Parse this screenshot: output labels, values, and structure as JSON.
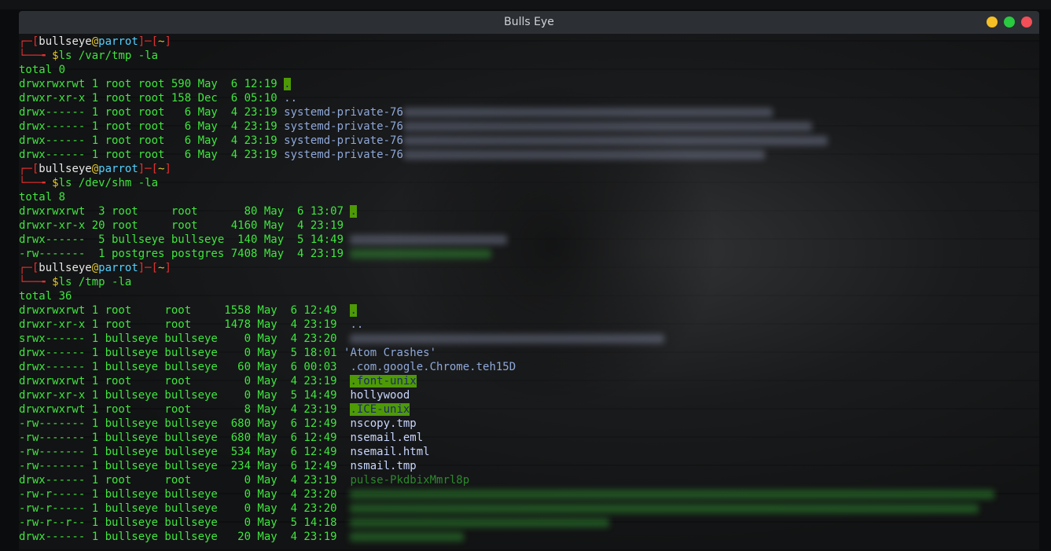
{
  "window": {
    "title": "Bulls Eye"
  },
  "prompt": {
    "bracket_open": "┌─[",
    "user": "bullseye",
    "at": "@",
    "host": "parrot",
    "mid": "]─[",
    "cwd": "~",
    "bracket_close": "]",
    "arrow": "└──╼ ",
    "dollar": "$"
  },
  "blocks": [
    {
      "command": "ls /var/tmp -la",
      "total": "total 0",
      "rows": [
        {
          "meta": "drwxrwxrwt 1 root root 590 May  6 12:19 ",
          "name": ".",
          "style": "hl"
        },
        {
          "meta": "drwxr-xr-x 1 root root 158 Dec  6 05:10 ",
          "name": "..",
          "style": "dir"
        },
        {
          "meta": "drwx------ 1 root root   6 May  4 23:19 ",
          "name": "systemd-private-76",
          "style": "dir"
        },
        {
          "meta": "drwx------ 1 root root   6 May  4 23:19 ",
          "name": "systemd-private-76",
          "style": "dir"
        },
        {
          "meta": "drwx------ 1 root root   6 May  4 23:19 ",
          "name": "systemd-private-76",
          "style": "dir"
        },
        {
          "meta": "drwx------ 1 root root   6 May  4 23:19 ",
          "name": "systemd-private-76",
          "style": "dir"
        }
      ]
    },
    {
      "command": "ls /dev/shm -la",
      "total": "total 8",
      "rows": [
        {
          "meta": "drwxrwxrwt  3 root     root       80 May  6 13:07 ",
          "name": ".",
          "style": "hl"
        },
        {
          "meta": "drwxr-xr-x 20 root     root     4160 May  4 23:19 ",
          "name": "",
          "style": "dir"
        },
        {
          "meta": "drwx------  5 bullseye bullseye  140 May  5 14:49 ",
          "name": "",
          "style": "dir"
        },
        {
          "meta": "-rw-------  1 postgres postgres 7408 May  4 23:19 ",
          "name": "",
          "style": "green"
        }
      ]
    },
    {
      "command": "ls /tmp -la",
      "total": "total 36",
      "rows": [
        {
          "meta": "drwxrwxrwt 1 root     root     1558 May  6 12:49  ",
          "name": ".",
          "style": "hl"
        },
        {
          "meta": "drwxr-xr-x 1 root     root     1478 May  4 23:19  ",
          "name": "..",
          "style": "dir"
        },
        {
          "meta": "srwx------ 1 bullseye bullseye    0 May  4 23:20  ",
          "name": "",
          "style": "dir"
        },
        {
          "meta": "drwx------ 1 bullseye bullseye    0 May  5 18:01 ",
          "name": "'Atom Crashes'",
          "style": "dir"
        },
        {
          "meta": "drwx------ 1 bullseye bullseye   60 May  6 00:03  ",
          "name": ".com.google.Chrome.teh15D",
          "style": "dir"
        },
        {
          "meta": "drwxrwxrwt 1 root     root        0 May  4 23:19  ",
          "name": ".font-unix",
          "style": "hl"
        },
        {
          "meta": "drwxr-xr-x 1 bullseye bullseye    0 May  5 14:49  ",
          "name": "hollywood",
          "style": "plain"
        },
        {
          "meta": "drwxrwxrwt 1 root     root        8 May  4 23:19  ",
          "name": ".ICE-unix",
          "style": "hl"
        },
        {
          "meta": "-rw------- 1 bullseye bullseye  680 May  6 12:49  ",
          "name": "nscopy.tmp",
          "style": "plain"
        },
        {
          "meta": "-rw------- 1 bullseye bullseye  680 May  6 12:49  ",
          "name": "nsemail.eml",
          "style": "plain"
        },
        {
          "meta": "-rw------- 1 bullseye bullseye  534 May  6 12:49  ",
          "name": "nsemail.html",
          "style": "plain"
        },
        {
          "meta": "-rw------- 1 bullseye bullseye  234 May  6 12:49  ",
          "name": "nsmail.tmp",
          "style": "plain"
        },
        {
          "meta": "drwx------ 1 root     root        0 May  4 23:19  ",
          "name": "pulse-PkdbixMmrl8p",
          "style": "faded"
        },
        {
          "meta": "-rw-r----- 1 bullseye bullseye    0 May  4 23:20  ",
          "name": "",
          "style": "green"
        },
        {
          "meta": "-rw-r----- 1 bullseye bullseye    0 May  4 23:20  ",
          "name": "",
          "style": "green"
        },
        {
          "meta": "-rw-r--r-- 1 bullseye bullseye    0 May  5 14:18  ",
          "name": "",
          "style": "green"
        },
        {
          "meta": "drwx------ 1 bullseye bullseye   20 May  4 23:19  ",
          "name": "",
          "style": "green"
        }
      ]
    }
  ]
}
